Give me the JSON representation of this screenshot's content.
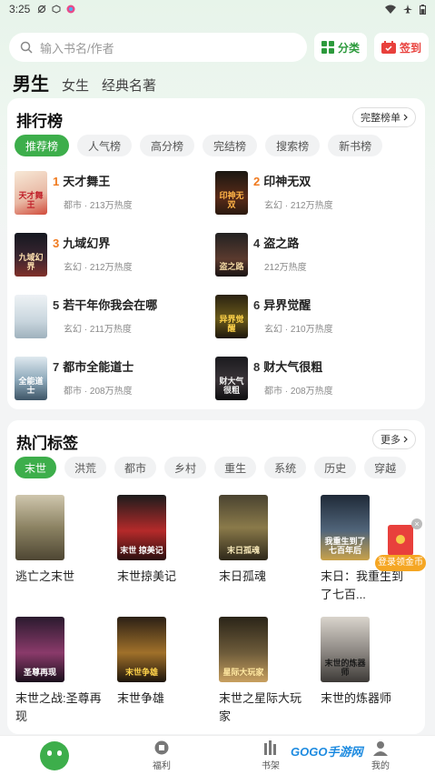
{
  "status_bar": {
    "time": "3:25"
  },
  "search": {
    "placeholder": "输入书名/作者"
  },
  "header_buttons": {
    "category": "分类",
    "checkin": "签到"
  },
  "gender_tabs": [
    "男生",
    "女生",
    "经典名著"
  ],
  "ranking": {
    "title": "排行榜",
    "full_list": "完整榜单",
    "tabs": [
      "推荐榜",
      "人气榜",
      "高分榜",
      "完结榜",
      "搜索榜",
      "新书榜"
    ],
    "items": [
      {
        "rank": "1",
        "title": "天才舞王",
        "meta": "都市 · 213万热度",
        "cover_text": "天才舞王"
      },
      {
        "rank": "2",
        "title": "印神无双",
        "meta": "玄幻 · 212万热度",
        "cover_text": "印神无双"
      },
      {
        "rank": "3",
        "title": "九域幻界",
        "meta": "玄幻 · 212万热度",
        "cover_text": "九域幻界"
      },
      {
        "rank": "4",
        "title": "盗之路",
        "meta": "212万热度",
        "cover_text": "盗之路"
      },
      {
        "rank": "5",
        "title": "若干年你我会在哪",
        "meta": "玄幻 · 211万热度",
        "cover_text": ""
      },
      {
        "rank": "6",
        "title": "异界觉醒",
        "meta": "玄幻 · 210万热度",
        "cover_text": "异界觉醒"
      },
      {
        "rank": "7",
        "title": "都市全能道士",
        "meta": "都市 · 208万热度",
        "cover_text": "全能道士"
      },
      {
        "rank": "8",
        "title": "财大气很粗",
        "meta": "都市 · 208万热度",
        "cover_text": "财大气很粗"
      }
    ]
  },
  "hot_tags": {
    "title": "热门标签",
    "more": "更多",
    "tags": [
      "末世",
      "洪荒",
      "都市",
      "乡村",
      "重生",
      "系统",
      "历史",
      "穿越"
    ],
    "books": [
      {
        "title": "逃亡之末世",
        "cover_text": ""
      },
      {
        "title": "末世掠美记",
        "cover_text": "末世 掠美记"
      },
      {
        "title": "末日孤魂",
        "cover_text": "末日孤魂"
      },
      {
        "title": "末日：我重生到了七百...",
        "cover_text": "我重生到了七百年后"
      },
      {
        "title": "末世之战:圣尊再现",
        "cover_text": "圣尊再现"
      },
      {
        "title": "末世争雄",
        "cover_text": "末世争雄"
      },
      {
        "title": "末世之星际大玩家",
        "cover_text": "星际大玩家"
      },
      {
        "title": "末世的炼器师",
        "cover_text": "末世的炼器师"
      }
    ]
  },
  "float_ad": {
    "label": "登录领金币"
  },
  "bottom_nav": [
    "福利",
    "书架",
    "我的"
  ],
  "watermark": {
    "brand": "GOGO手游网"
  }
}
